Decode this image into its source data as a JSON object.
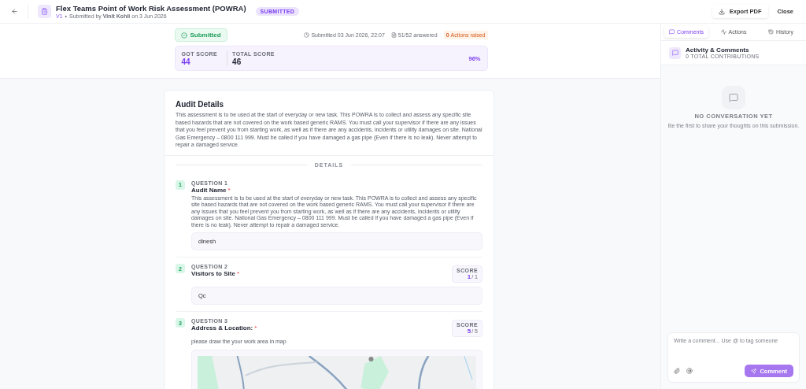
{
  "header": {
    "title": "Flex Teams Point of Work Risk Assessment (POWRA)",
    "version": "V1",
    "separator": "•",
    "subtitle": "Submitted by **Vinit Kohli** on 3 Jun 2026",
    "badge": "SUBMITTED",
    "export_button": "Export PDF",
    "close_button": "Close"
  },
  "summary": {
    "status": "Submitted",
    "submitted": "Submitted 03 Jun 2026, 22:07",
    "answered": "51/52 answered",
    "actions_count": "0",
    "actions_label": "Actions raised",
    "got_score_label": "GOT SCORE",
    "got_score": "44",
    "total_score_label": "TOTAL SCORE",
    "total_score": "46",
    "percent": "96%"
  },
  "audit": {
    "title": "Audit Details",
    "description": "This assessment is to be used at the start of everyday or new task. This POWRA is to collect and assess any specific site based hazards that are not covered on the work based generic RAMS. You must call your supervisor if there are any issues that you feel prevent you from starting work, as well as if there are any accidents, incidents or utility damages on site. National Gas Emergency – 0800 111 999. Must be called if you have damaged a gas pipe (Even if there is no leak). Never attempt to repair a damaged service.",
    "section": "DETAILS",
    "questions": [
      {
        "kind": "text",
        "number": "1",
        "label": "QUESTION 1",
        "title": "Audit Name",
        "required_mark": "*",
        "help": "This assessment is to be used at the start of everyday or new task. This POWRA is to collect and assess any specific site based hazards that are not covered on the work based generic RAMS. You must call your supervisor if there are any issues that you feel prevent you from starting work, as well as if there are any accidents, incidents or utility damages on site. National Gas Emergency – 0800 111 999. Must be called if you have damaged a gas pipe (Even if there is no leak). Never attempt to repair a damaged service.",
        "answer": "dinesh"
      },
      {
        "kind": "text",
        "number": "2",
        "label": "QUESTION 2",
        "title": "Visitors to Site",
        "required_mark": "*",
        "score_label": "SCORE",
        "score": "1",
        "score_max": "/ 1",
        "answer": "Qc"
      },
      {
        "kind": "map",
        "number": "3",
        "label": "QUESTION 3",
        "title": "Address & Location:",
        "required_mark": "*",
        "score_label": "SCORE",
        "score": "5",
        "score_max": "/ 5",
        "help": "please draw the your work area in map"
      }
    ]
  },
  "sidebar": {
    "tabs": [
      {
        "label": "Comments",
        "selected": true
      },
      {
        "label": "Actions",
        "selected": false
      },
      {
        "label": "History",
        "selected": false
      }
    ],
    "title": "Activity & Comments",
    "count": "0 TOTAL CONTRIBUTIONS",
    "empty_title": "NO CONVERSATION YET",
    "empty_text": "Be the first to share your thoughts on this submission.",
    "placeholder": "Write a comment... Use @ to tag someone",
    "send_button": "Comment"
  }
}
